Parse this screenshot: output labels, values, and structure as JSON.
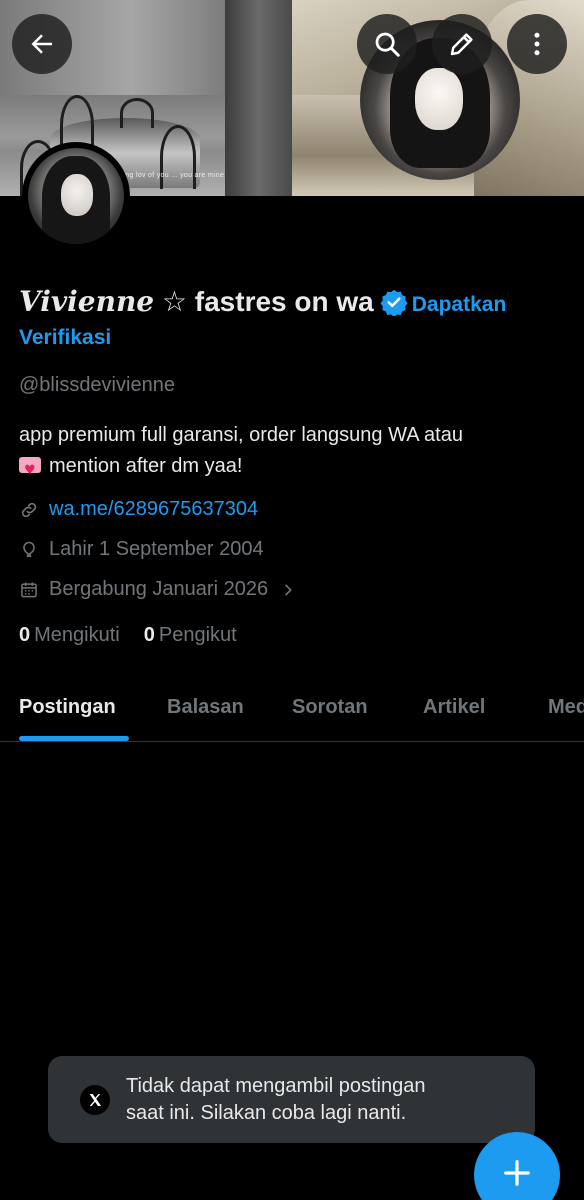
{
  "banner": {
    "caption": "i'm missing lov of you ... you are mine"
  },
  "header": {
    "back_icon": "arrow-left-icon",
    "search_icon": "search-icon",
    "edit_icon": "edit-pencil-icon",
    "more_icon": "more-vertical-icon"
  },
  "profile": {
    "name_script": "Vivienne",
    "name_rest": " ☆ fastres on wa",
    "get_verified_line1": "Dapatkan",
    "get_verified_line2": "Verifikasi",
    "handle": "@blissdevivienne",
    "bio_line1": "app premium full garansi, order langsung WA atau",
    "bio_line2": "mention after dm yaa!",
    "link": "wa.me/6289675637304",
    "birth": "Lahir 1 September 2004",
    "joined": "Bergabung Januari 2026",
    "following_count": "0",
    "following_label": "Mengikuti",
    "followers_count": "0",
    "followers_label": "Pengikut"
  },
  "tabs": [
    {
      "label": "Postingan"
    },
    {
      "label": "Balasan"
    },
    {
      "label": "Sorotan"
    },
    {
      "label": "Artikel"
    },
    {
      "label": "Media"
    }
  ],
  "toast": {
    "line1": "Tidak dapat mengambil postingan",
    "line2": "saat ini. Silakan coba lagi nanti."
  },
  "colors": {
    "accent": "#1d9bf0",
    "background": "#000000",
    "text_primary": "#e7e9ea",
    "text_secondary": "#71767b",
    "toast_bg": "#2f3336"
  }
}
